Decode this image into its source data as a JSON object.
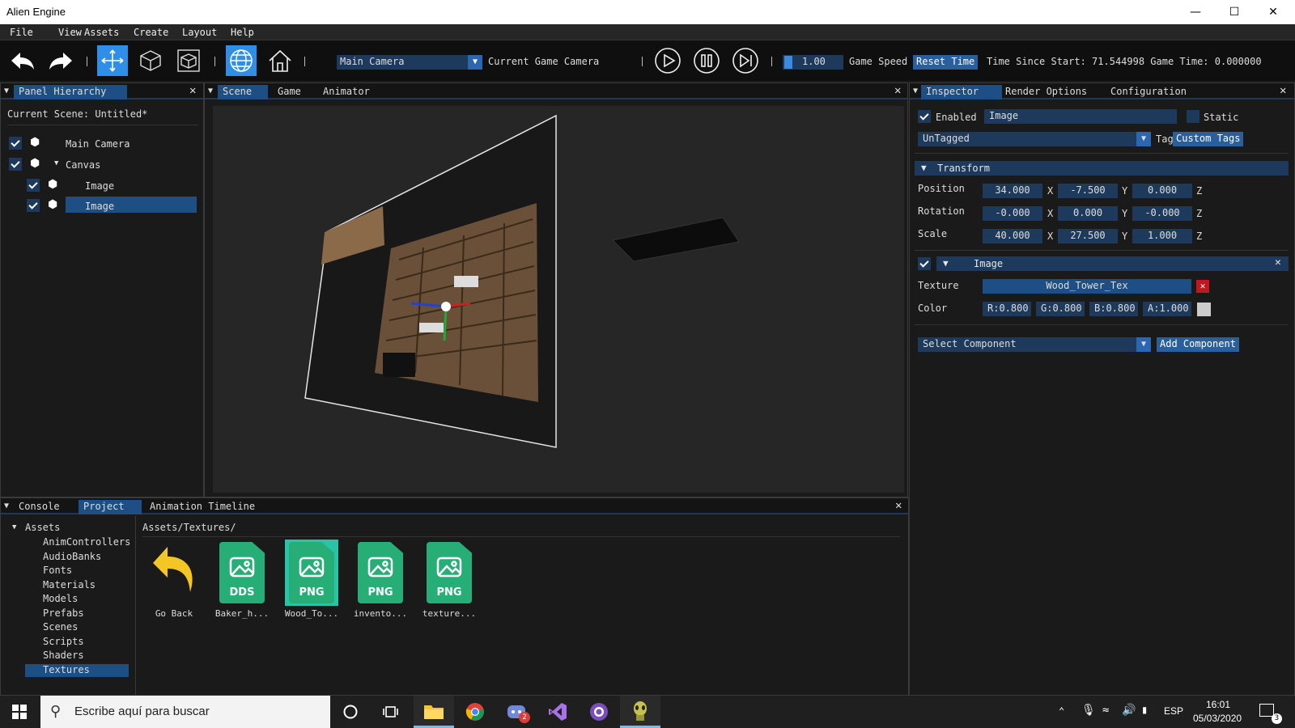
{
  "window": {
    "title": "Alien Engine"
  },
  "menu": [
    "File",
    "View",
    "Assets",
    "Create",
    "Layout",
    "Help"
  ],
  "toolbar": {
    "camera_combo": "Main Camera",
    "camera_label": "Current Game Camera",
    "speed_value": "1.00",
    "speed_label": "Game Speed",
    "reset_label": "Reset Time",
    "time_text": "Time Since Start: 71.544998 Game Time: 0.000000"
  },
  "hierarchy": {
    "tab": "Panel Hierarchy",
    "scene": "Current Scene: Untitled*",
    "items": [
      "Main Camera",
      "Canvas",
      "Image",
      "Image"
    ]
  },
  "scene_tabs": [
    "Scene",
    "Game",
    "Animator"
  ],
  "inspector": {
    "tabs": [
      "Inspector",
      "Render Options",
      "Configuration"
    ],
    "enabled_label": "Enabled",
    "name": "Image",
    "static_label": "Static",
    "tag_value": "UnTagged",
    "tag_label": "Tag",
    "custom_tags": "Custom Tags",
    "transform": {
      "header": "Transform",
      "position_label": "Position",
      "rotation_label": "Rotation",
      "scale_label": "Scale",
      "position": [
        "34.000",
        "-7.500",
        "0.000"
      ],
      "rotation": [
        "-0.000",
        "0.000",
        "-0.000"
      ],
      "scale": [
        "40.000",
        "27.500",
        "1.000"
      ],
      "axes": [
        "X",
        "Y",
        "Z"
      ]
    },
    "image": {
      "header": "Image",
      "texture_label": "Texture",
      "texture": "Wood_Tower_Tex",
      "color_label": "Color",
      "color": [
        "R:0.800",
        "G:0.800",
        "B:0.800",
        "A:1.000"
      ]
    },
    "select_component": "Select Component",
    "add_component": "Add Component"
  },
  "bottom": {
    "tabs": [
      "Console",
      "Project",
      "Animation Timeline"
    ],
    "root": "Assets",
    "folders": [
      "AnimControllers",
      "AudioBanks",
      "Fonts",
      "Materials",
      "Models",
      "Prefabs",
      "Scenes",
      "Scripts",
      "Shaders",
      "Textures"
    ],
    "path": "Assets/Textures/",
    "go_back": "Go Back",
    "files": [
      {
        "ext": "DDS",
        "name": "Baker_h..."
      },
      {
        "ext": "PNG",
        "name": "Wood_To..."
      },
      {
        "ext": "PNG",
        "name": "invento..."
      },
      {
        "ext": "PNG",
        "name": "texture..."
      }
    ]
  },
  "taskbar": {
    "search_placeholder": "Escribe aquí para buscar",
    "lang": "ESP",
    "time": "16:01",
    "date": "05/03/2020",
    "notif_badge": "3",
    "chat_badge": "2"
  },
  "colors": {
    "accent": "#1d4f85",
    "field": "#1d3a5c",
    "asset_green": "#27ae76",
    "remove_red": "#c0181e"
  }
}
